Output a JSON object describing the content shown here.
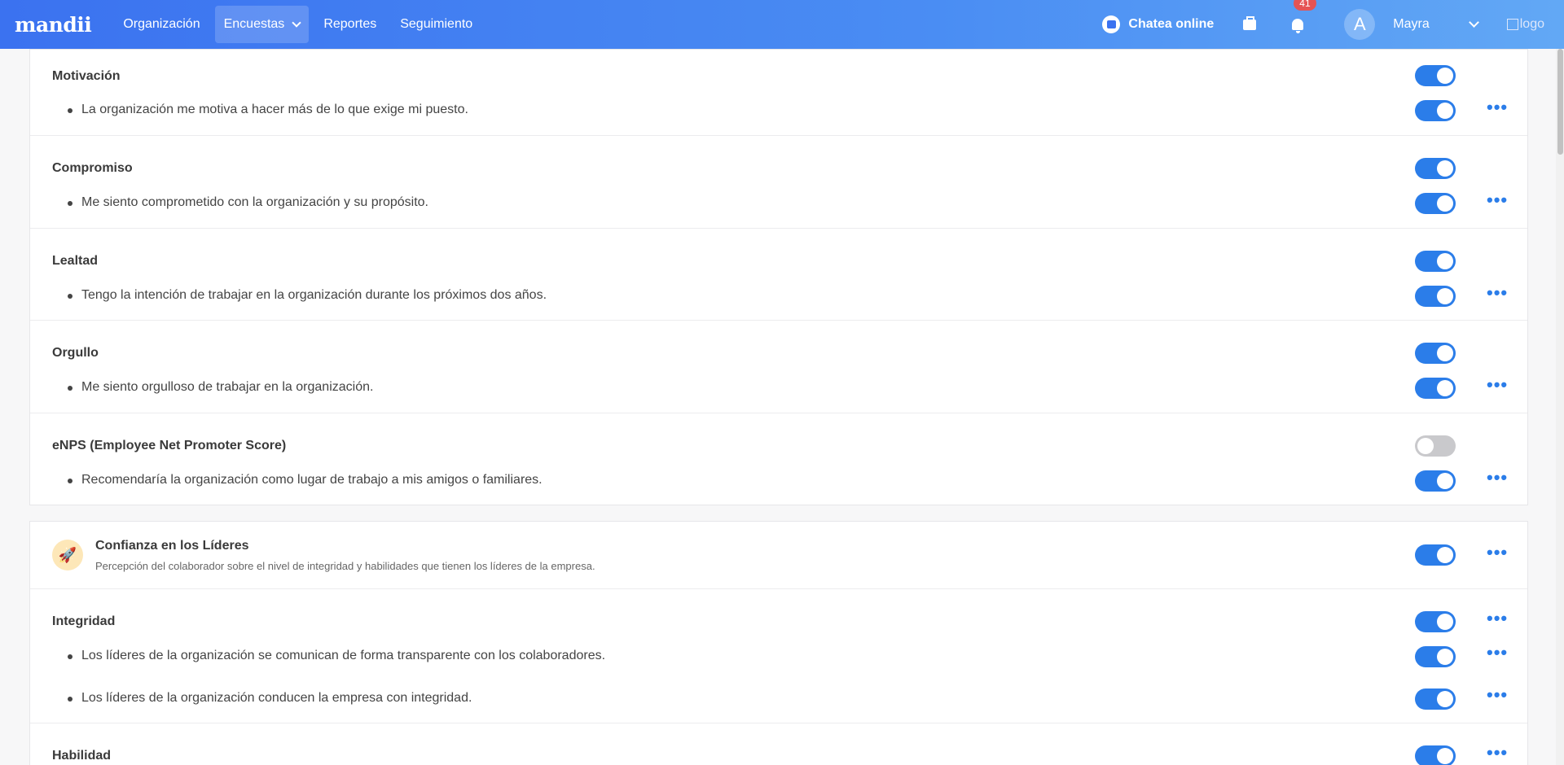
{
  "nav": {
    "brand": "mandii",
    "items": [
      "Organización",
      "Encuestas",
      "Reportes",
      "Seguimiento"
    ],
    "chat_label": "Chatea online",
    "notifications_count": "41",
    "avatar_initial": "A",
    "user_name": "Mayra",
    "logo_alt": "logo"
  },
  "sections": [
    {
      "category": "Motivación",
      "category_enabled": true,
      "question": "La organización me motiva a hacer más de lo que exige mi puesto.",
      "question_enabled": true
    },
    {
      "category": "Compromiso",
      "category_enabled": true,
      "question": "Me siento comprometido con la organización y su propósito.",
      "question_enabled": true
    },
    {
      "category": "Lealtad",
      "category_enabled": true,
      "question": "Tengo la intención de trabajar en la organización durante los próximos dos años.",
      "question_enabled": true
    },
    {
      "category": "Orgullo",
      "category_enabled": true,
      "question": "Me siento orgulloso de trabajar en la organización.",
      "question_enabled": true
    },
    {
      "category": "eNPS (Employee Net Promoter Score)",
      "category_enabled": false,
      "question": "Recomendaría la organización como lugar de trabajo a mis amigos o familiares.",
      "question_enabled": true
    }
  ],
  "leaders_section": {
    "icon": "rocket-icon",
    "title": "Confianza en los Líderes",
    "description": "Percepción del colaborador sobre el nivel de integridad y habilidades que tienen los líderes de la empresa.",
    "enabled": true,
    "integridad": {
      "category": "Integridad",
      "category_enabled": true,
      "questions": [
        "Los líderes de la organización se comunican de forma transparente con los colaboradores.",
        "Los líderes de la organización conducen la empresa con integridad."
      ]
    },
    "habilidad": {
      "category": "Habilidad",
      "category_enabled": true
    }
  },
  "colors": {
    "accent": "#2b7de9",
    "nav_start": "#3b72f0",
    "nav_end": "#62a8f5",
    "badge": "#e55454"
  }
}
